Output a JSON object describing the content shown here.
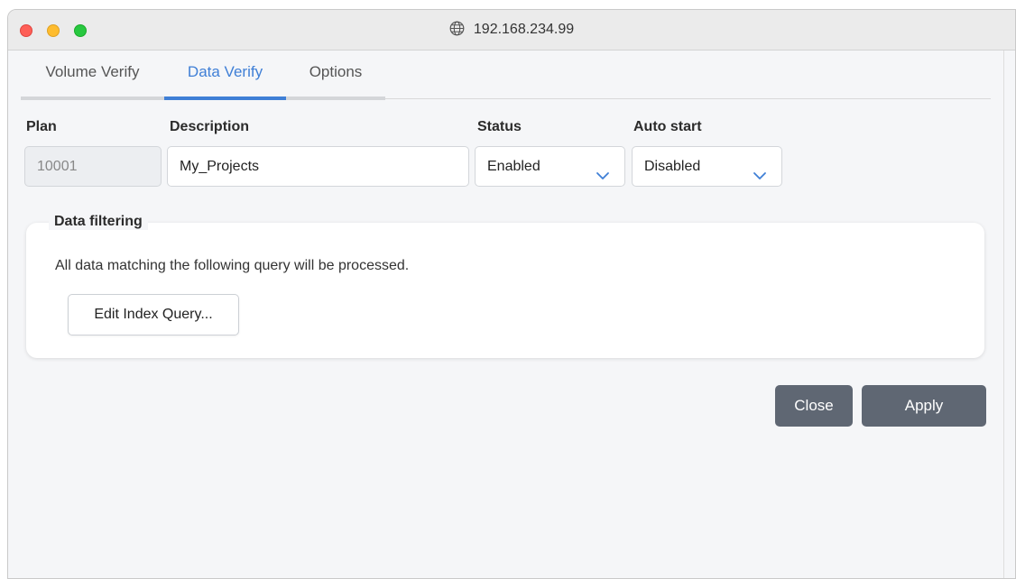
{
  "window": {
    "title": "192.168.234.99"
  },
  "tabs": [
    {
      "label": "Volume Verify",
      "active": false
    },
    {
      "label": "Data Verify",
      "active": true
    },
    {
      "label": "Options",
      "active": false
    }
  ],
  "form": {
    "plan": {
      "label": "Plan",
      "value": "10001"
    },
    "description": {
      "label": "Description",
      "value": "My_Projects"
    },
    "status": {
      "label": "Status",
      "value": "Enabled"
    },
    "auto_start": {
      "label": "Auto start",
      "value": "Disabled"
    }
  },
  "filtering": {
    "legend": "Data filtering",
    "description": "All data matching the following query will be processed.",
    "button_label": "Edit Index Query..."
  },
  "actions": {
    "close_label": "Close",
    "apply_label": "Apply"
  },
  "colors": {
    "accent": "#3f7fd6",
    "button_dark": "#5f6773",
    "close_light": "#fe5f57",
    "minimize_light": "#febc2e",
    "zoom_light": "#28c840"
  },
  "icons": [
    "globe-icon",
    "chevron-down-icon"
  ]
}
